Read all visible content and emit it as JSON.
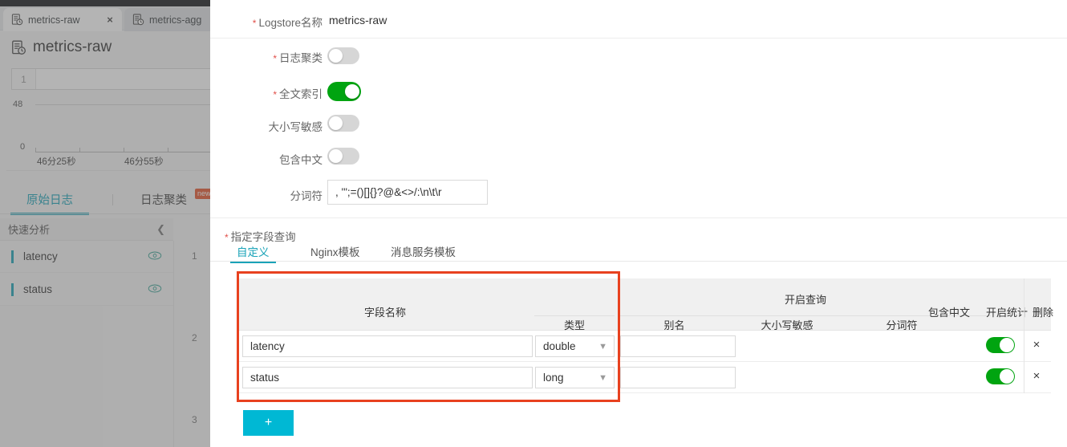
{
  "browser": {
    "tabs": [
      {
        "title": "metrics-raw",
        "icon": "logstore-icon",
        "active": true,
        "close_label": "×"
      },
      {
        "title": "metrics-agg",
        "icon": "logstore-icon",
        "active": false
      }
    ]
  },
  "background": {
    "page_title": "metrics-raw",
    "search_gutter_number": "1",
    "chart": {
      "y_top": "48",
      "y_bottom": "0",
      "x_ticks": [
        "46分25秒",
        "46分55秒"
      ]
    },
    "log_tabs": [
      {
        "label": "原始日志",
        "selected": true
      },
      {
        "label": "日志聚类",
        "selected": false,
        "badge": "new"
      }
    ],
    "quick_analysis": {
      "title": "快速分析",
      "collapse_icon": "chevron-left-icon",
      "items": [
        {
          "label": "latency",
          "icon": "eye-icon"
        },
        {
          "label": "status",
          "icon": "eye-icon"
        }
      ]
    },
    "gutter_numbers": [
      "1",
      "2",
      "3"
    ]
  },
  "panel": {
    "fields": [
      {
        "label": "Logstore名称",
        "required": true,
        "value": "metrics-raw"
      },
      {
        "label": "日志聚类",
        "required": true,
        "toggle": "off"
      },
      {
        "label": "全文索引",
        "required": true,
        "toggle": "on"
      },
      {
        "label": "大小写敏感",
        "required": false,
        "toggle": "off"
      },
      {
        "label": "包含中文",
        "required": false,
        "toggle": "off"
      },
      {
        "label": "分词符",
        "required": false,
        "input_value": ", '\";=()[]{}?@&<>/:\\n\\t\\r"
      }
    ],
    "section_label": "指定字段查询",
    "section_required": true,
    "subtabs": [
      {
        "label": "自定义",
        "active": true
      },
      {
        "label": "Nginx模板",
        "active": false
      },
      {
        "label": "消息服务模板",
        "active": false
      }
    ],
    "table": {
      "group_headers": [
        {
          "label": "字段名称"
        },
        {
          "label": "开启查询"
        }
      ],
      "columns": [
        {
          "label": "类型"
        },
        {
          "label": "别名"
        },
        {
          "label": "大小写敏感"
        },
        {
          "label": "分词符"
        },
        {
          "label": "包含中文"
        },
        {
          "label": "开启统计"
        },
        {
          "label": "删除"
        }
      ],
      "rows": [
        {
          "field_name": "latency",
          "type": "double",
          "alias": "",
          "case_sensitive": "",
          "delimiter": "",
          "contains_chinese": "",
          "enable_stats": "on",
          "delete_icon": "×"
        },
        {
          "field_name": "status",
          "type": "long",
          "alias": "",
          "case_sensitive": "",
          "delimiter": "",
          "contains_chinese": "",
          "enable_stats": "on",
          "delete_icon": "×"
        }
      ]
    },
    "add_button_label": "+",
    "highlight_color": "#e8411f",
    "accent_color": "#1aa3b8",
    "toggle_on_color": "#00a410",
    "add_button_color": "#00b8d4"
  }
}
